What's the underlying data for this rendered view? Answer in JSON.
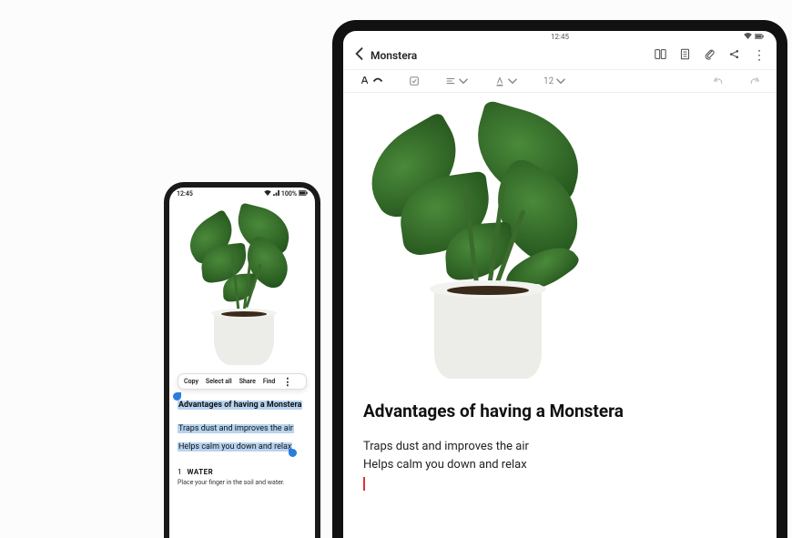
{
  "phone": {
    "statusbar": {
      "time": "12:45",
      "battery": "100%"
    },
    "context_menu": {
      "copy": "Copy",
      "select_all": "Select all",
      "share": "Share",
      "find": "Find"
    },
    "selection": {
      "title": "Advantages of having a Monstera",
      "line1": "Traps dust and improves the air",
      "line2": "Helps calm you down and relax"
    },
    "section": {
      "number": "1",
      "title": "WATER",
      "body": "Place your finger in the soil and water."
    }
  },
  "tablet": {
    "statusbar": {
      "time": "12:45"
    },
    "appbar": {
      "title": "Monstera"
    },
    "toolbar": {
      "font_size": "12"
    },
    "note": {
      "title": "Advantages of having a Monstera",
      "line1": "Traps dust and improves the air",
      "line2": "Helps calm you down and relax"
    }
  }
}
